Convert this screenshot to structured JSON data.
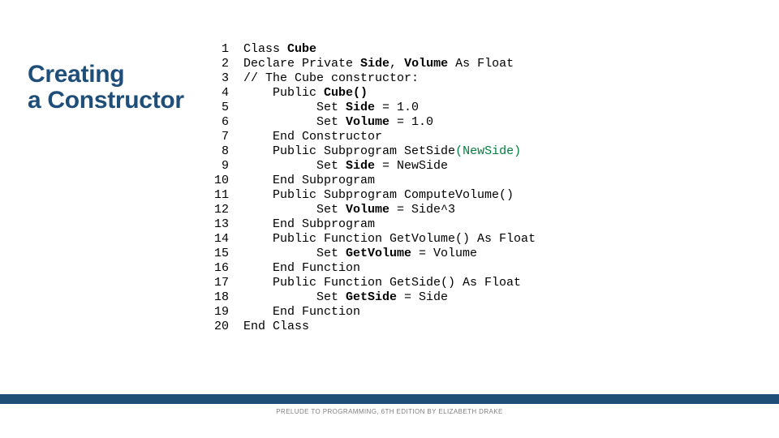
{
  "title_line1": "Creating",
  "title_line2": "a Constructor",
  "footer": "PRELUDE TO PROGRAMMING, 6TH EDITION BY ELIZABETH DRAKE",
  "lines": [
    {
      "num": "1",
      "ind": "",
      "pre": "Class ",
      "bold": "Cube",
      "post": ""
    },
    {
      "num": "2",
      "ind": "",
      "pre": "Declare Private ",
      "bold": "Side",
      "post": ", ",
      "bold2": "Volume",
      "post2": " As Float"
    },
    {
      "num": "3",
      "ind": "",
      "pre": "// The Cube constructor:",
      "bold": "",
      "post": ""
    },
    {
      "num": "4",
      "ind": "    ",
      "pre": "Public ",
      "bold": "Cube()",
      "post": ""
    },
    {
      "num": "5",
      "ind": "          ",
      "pre": "Set ",
      "bold": "Side",
      "post": " = 1.0"
    },
    {
      "num": "6",
      "ind": "          ",
      "pre": "Set ",
      "bold": "Volume",
      "post": " = 1.0"
    },
    {
      "num": "7",
      "ind": "    ",
      "pre": "End Constructor",
      "bold": "",
      "post": ""
    },
    {
      "num": "8",
      "ind": "    ",
      "pre": "Public Subprogram SetSide",
      "green": "(NewSide)"
    },
    {
      "num": "9",
      "ind": "          ",
      "pre": "Set ",
      "bold": "Side",
      "post": " = NewSide"
    },
    {
      "num": "10",
      "ind": "    ",
      "pre": "End Subprogram",
      "bold": "",
      "post": ""
    },
    {
      "num": "11",
      "ind": "    ",
      "pre": "Public Subprogram ComputeVolume()",
      "bold": "",
      "post": ""
    },
    {
      "num": "12",
      "ind": "          ",
      "pre": "Set ",
      "bold": "Volume",
      "post": " = Side^3"
    },
    {
      "num": "13",
      "ind": "    ",
      "pre": "End Subprogram",
      "bold": "",
      "post": ""
    },
    {
      "num": "14",
      "ind": "    ",
      "pre": "Public Function GetVolume() As Float",
      "bold": "",
      "post": ""
    },
    {
      "num": "15",
      "ind": "          ",
      "pre": "Set ",
      "bold": "GetVolume",
      "post": " = Volume"
    },
    {
      "num": "16",
      "ind": "    ",
      "pre": "End Function",
      "bold": "",
      "post": ""
    },
    {
      "num": "17",
      "ind": "    ",
      "pre": "Public Function GetSide() As Float",
      "bold": "",
      "post": ""
    },
    {
      "num": "18",
      "ind": "          ",
      "pre": "Set ",
      "bold": "GetSide",
      "post": " = Side"
    },
    {
      "num": "19",
      "ind": "    ",
      "pre": "End Function",
      "bold": "",
      "post": ""
    },
    {
      "num": "20",
      "ind": "",
      "pre": "End Class",
      "bold": "",
      "post": ""
    }
  ]
}
